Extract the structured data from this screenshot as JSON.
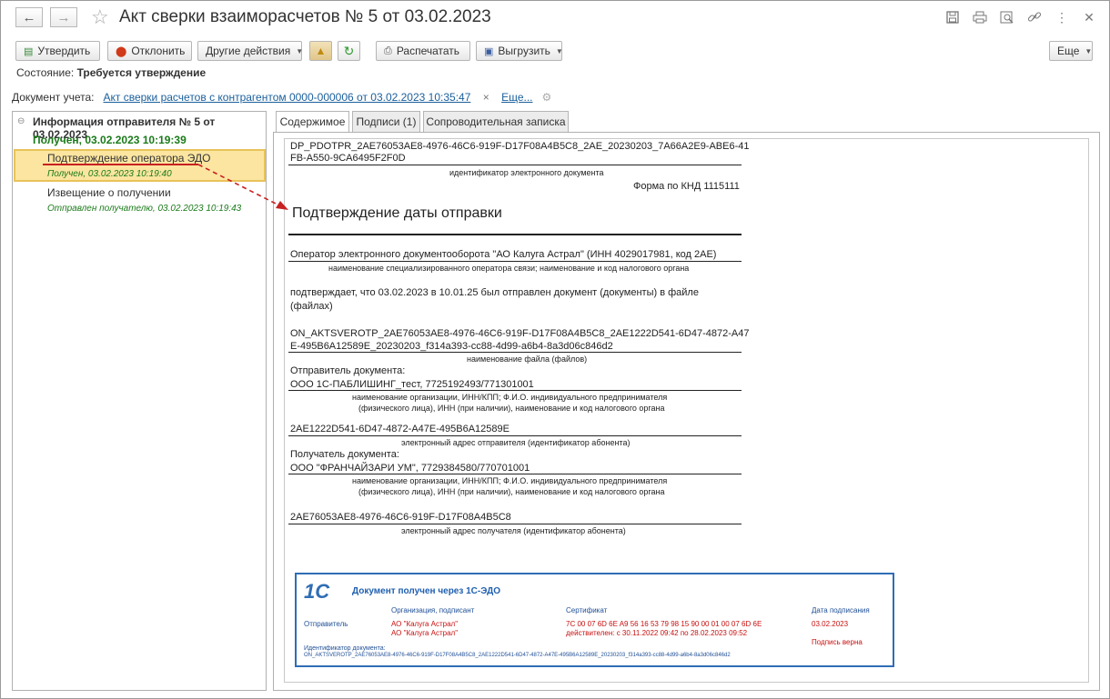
{
  "window": {
    "title": "Акт сверки взаиморасчетов № 5 от 03.02.2023"
  },
  "toolbar": {
    "approve": "Утвердить",
    "reject": "Отклонить",
    "other_actions": "Другие действия",
    "print": "Распечатать",
    "export": "Выгрузить",
    "more": "Еще"
  },
  "status": {
    "label": "Состояние:",
    "value": "Требуется утверждение"
  },
  "document_account": {
    "label": "Документ учета:",
    "link": "Акт сверки расчетов с контрагентом 0000-000006 от 03.02.2023 10:35:47",
    "clear": "×",
    "more_link": "Еще..."
  },
  "tree": {
    "header": "Информация отправителя № 5 от 03.02.2023",
    "received": "Получен, 03.02.2023 10:19:39",
    "items": [
      {
        "label": "Подтверждение оператора ЭДО",
        "sub": "Получен, 03.02.2023 10:19:40"
      },
      {
        "label": "Извещение о получении",
        "sub": "Отправлен получателю, 03.02.2023 10:19:43"
      }
    ]
  },
  "tabs": [
    "Содержимое",
    "Подписи (1)",
    "Сопроводительная записка"
  ],
  "document": {
    "id_line1": "DP_PDOTPR_2AE76053AE8-4976-46C6-919F-D17F08A4B5C8_2AE_20230203_7A66A2E9-ABE6-41",
    "id_line2": "FB-A550-9CA6495F2F0D",
    "id_caption": "идентификатор электронного документа",
    "form": "Форма по КНД 1115111",
    "heading": "Подтверждение даты отправки",
    "operator": "Оператор электронного документооборота \"АО Калуга Астрал\" (ИНН 4029017981, код 2АЕ)",
    "operator_caption": "наименование специализированного оператора связи; наименование и код налогового органа",
    "confirms_line1": "подтверждает, что 03.02.2023 в 10.01.25 был отправлен документ (документы) в файле",
    "confirms_line2": "(файлах)",
    "file_line1": "ON_AKTSVEROTP_2AE76053AE8-4976-46C6-919F-D17F08A4B5C8_2AE1222D541-6D47-4872-A47",
    "file_line2": "E-495B6A12589E_20230203_f314a393-cc88-4d99-a6b4-8a3d06c846d2",
    "file_caption": "наименование файла (файлов)",
    "sender_label": "Отправитель документа:",
    "sender": "ООО 1С-ПАБЛИШИНГ_тест, 7725192493/771301001",
    "org_caption1": "наименование организации, ИНН/КПП; Ф.И.О. индивидуального предпринимателя",
    "org_caption2": "(физического лица), ИНН (при наличии), наименование и код налогового органа",
    "sender_addr": "2AE1222D541-6D47-4872-A47E-495B6A12589E",
    "sender_addr_caption": "электронный адрес отправителя (идентификатор абонента)",
    "receiver_label": "Получатель документа:",
    "receiver": "ООО \"ФРАНЧАЙЗАРИ УМ\", 7729384580/770701001",
    "receiver_addr": "2AE76053AE8-4976-46C6-919F-D17F08A4B5C8",
    "receiver_addr_caption": "электронный адрес получателя (идентификатор абонента)"
  },
  "stamp": {
    "logo": "1С",
    "title": "Документ получен через 1С-ЭДО",
    "col_org": "Организация, подписант",
    "col_cert": "Сертификат",
    "col_date": "Дата подписания",
    "row_label": "Отправитель",
    "org1": "АО \"Калуга Астрал\"",
    "org2": "АО \"Калуга Астрал\"",
    "cert1": "7C 00 07 6D 6E A9 56 16 53 79 98 15 90 00 01 00 07 6D 6E",
    "cert2": "действителен: с 30.11.2022 09:42 по 28.02.2023 09:52",
    "date": "03.02.2023",
    "sig_ok": "Подпись верна",
    "id_label": "Идентификатор документа:",
    "id_value": "ON_AKTSVEROTP_2AE76053AE8-4976-46C6-919F-D17F08A4B5C8_2AE1222D541-6D47-4872-A47E-495B6A12589E_20230203_f314a393-cc88-4d99-a6b4-8a3d06c846d2"
  },
  "colors": {
    "accent_green": "#1a7a1a",
    "selection": "#fbe5a0",
    "link": "#1a5f9c",
    "stamp_blue": "#2f6db5",
    "stamp_red": "#c81010"
  }
}
